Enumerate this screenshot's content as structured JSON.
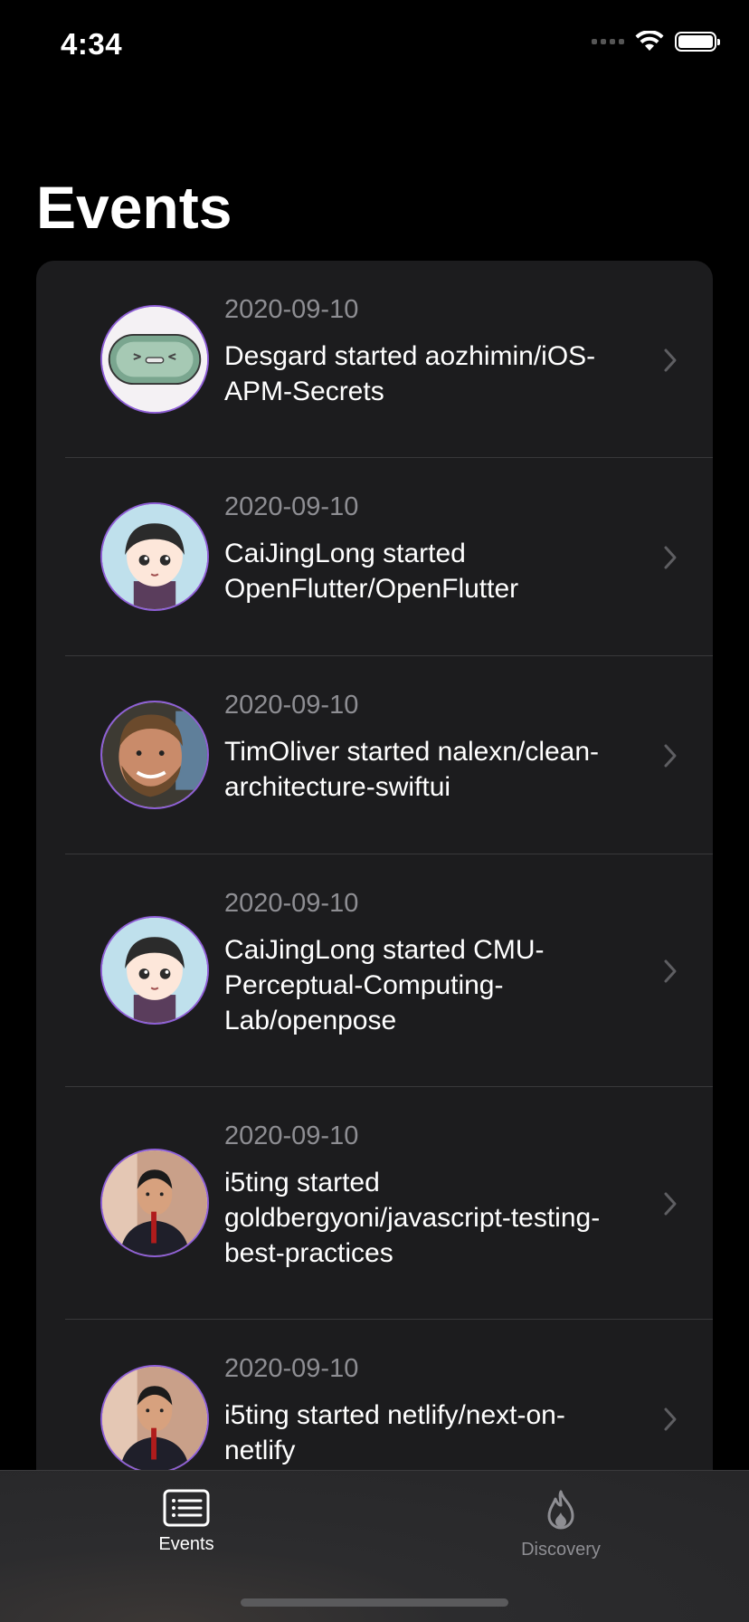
{
  "status_bar": {
    "time": "4:34"
  },
  "header": {
    "title": "Events"
  },
  "events": [
    {
      "date": "2020-09-10",
      "text": "Desgard started aozhimin/iOS-APM-Secrets",
      "avatar": "green-toy-avatar"
    },
    {
      "date": "2020-09-10",
      "text": "CaiJingLong started OpenFlutter/OpenFlutter",
      "avatar": "anime-boy-avatar"
    },
    {
      "date": "2020-09-10",
      "text": "TimOliver started nalexn/clean-architecture-swiftui",
      "avatar": "bearded-man-avatar"
    },
    {
      "date": "2020-09-10",
      "text": "CaiJingLong started CMU-Perceptual-Computing-Lab/openpose",
      "avatar": "anime-boy-avatar"
    },
    {
      "date": "2020-09-10",
      "text": "i5ting started goldbergyoni/javascript-testing-best-practices",
      "avatar": "speaker-avatar"
    },
    {
      "date": "2020-09-10",
      "text": "i5ting started netlify/next-on-netlify",
      "avatar": "speaker-avatar"
    }
  ],
  "tab_bar": {
    "tabs": [
      {
        "label": "Events",
        "icon": "list-icon",
        "selected": true
      },
      {
        "label": "Discovery",
        "icon": "flame-icon",
        "selected": false
      }
    ]
  },
  "colors": {
    "background": "#000000",
    "card": "#1c1c1e",
    "secondary_text": "#8e8e93",
    "avatar_ring": "#8e5fd6"
  }
}
